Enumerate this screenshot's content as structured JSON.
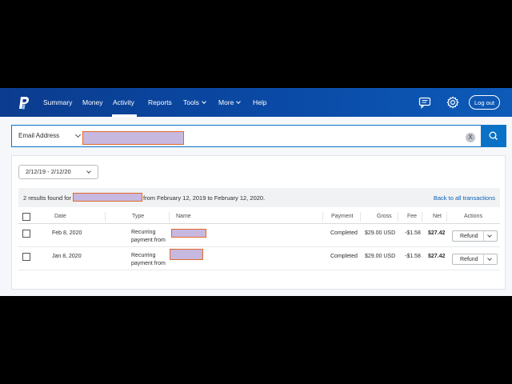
{
  "nav": {
    "items": [
      {
        "label": "Summary"
      },
      {
        "label": "Money"
      },
      {
        "label": "Activity"
      },
      {
        "label": "Reports"
      },
      {
        "label": "Tools"
      },
      {
        "label": "More"
      },
      {
        "label": "Help"
      }
    ],
    "logout_label": "Log out",
    "colors": {
      "brand": "#0a4aa6",
      "accent": "#0a72c6"
    }
  },
  "search": {
    "field_label": "Email Address",
    "clear_label": "X"
  },
  "filters": {
    "date_range": "2/12/19 - 2/12/20"
  },
  "results": {
    "prefix": "2 results found for",
    "suffix": "from February 12, 2019 to February 12, 2020.",
    "back_link": "Back to all transactions"
  },
  "table": {
    "headers": {
      "date": "Date",
      "type": "Type",
      "name": "Name",
      "payment": "Payment",
      "gross": "Gross",
      "fee": "Fee",
      "net": "Net",
      "actions": "Actions"
    },
    "rows": [
      {
        "date": "Feb 8, 2020",
        "type_line1": "Recurring",
        "type_line2": "payment from",
        "payment": "Completed",
        "gross": "$29.00 USD",
        "fee": "-$1.58",
        "net": "$27.42",
        "action": "Refund"
      },
      {
        "date": "Jan 8, 2020",
        "type_line1": "Recurring",
        "type_line2": "payment from",
        "payment": "Completed",
        "gross": "$29.00 USD",
        "fee": "-$1.58",
        "net": "$27.42",
        "action": "Refund"
      }
    ]
  }
}
